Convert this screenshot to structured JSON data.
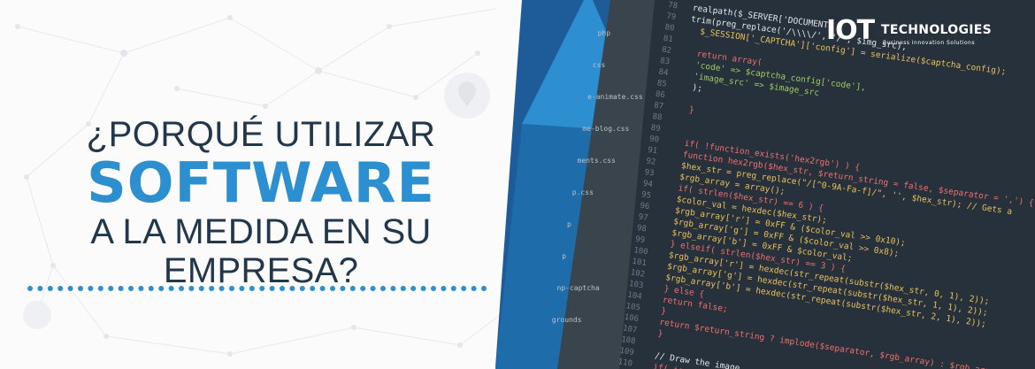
{
  "headline": {
    "line1": "¿PORQUÉ UTILIZAR",
    "line2": "SOFTWARE",
    "line3": "A LA MEDIDA EN SU EMPRESA?"
  },
  "logo": {
    "mark": "IOT",
    "name": "TECHNOLOGIES",
    "tagline": "Business Innovation Solutions"
  },
  "colors": {
    "accent_blue": "#2b8fd0",
    "dark_blue": "#1f5e9c",
    "navy_text": "#22374b",
    "editor_bg": "#2a3540"
  },
  "editor": {
    "sidebar_files": [
      "php",
      "css",
      "e-animate.css",
      "me-blog.css",
      "ments.css",
      "p.css",
      "p",
      "p",
      "np-captcha",
      "grounds"
    ],
    "code_lines": [
      {
        "num": "78",
        "text": "realpath($_SERVER['DOCUMENT"
      },
      {
        "num": "79",
        "text": "trim(preg_replace('/\\\\\\\\/', '/', $img_src),"
      },
      {
        "num": "80",
        "text": "$_SESSION['_CAPTCHA']['config'] = serialize($captcha_config);"
      },
      {
        "num": "81",
        "text": ""
      },
      {
        "num": "82",
        "text": "return array("
      },
      {
        "num": "83",
        "text": "'code' => $captcha_config['code'],"
      },
      {
        "num": "84",
        "text": "'image_src' => $image_src"
      },
      {
        "num": "85",
        "text": ");"
      },
      {
        "num": "86",
        "text": ""
      },
      {
        "num": "87",
        "text": "}"
      },
      {
        "num": "88",
        "text": ""
      },
      {
        "num": "89",
        "text": ""
      },
      {
        "num": "90",
        "text": "if( !function_exists('hex2rgb') ) {"
      },
      {
        "num": "91",
        "text": "function hex2rgb($hex_str, $return_string = false, $separator = ',') {"
      },
      {
        "num": "92",
        "text": "$hex_str = preg_replace(\"/[^0-9A-Fa-f]/\", '', $hex_str); // Gets a"
      },
      {
        "num": "93",
        "text": "$rgb_array = array();"
      },
      {
        "num": "94",
        "text": "if( strlen($hex_str) == 6 ) {"
      },
      {
        "num": "95",
        "text": "$color_val = hexdec($hex_str);"
      },
      {
        "num": "96",
        "text": "$rgb_array['r'] = 0xFF & ($color_val >> 0x10);"
      },
      {
        "num": "97",
        "text": "$rgb_array['g'] = 0xFF & ($color_val >> 0x8);"
      },
      {
        "num": "98",
        "text": "$rgb_array['b'] = 0xFF & $color_val;"
      },
      {
        "num": "99",
        "text": "} elseif( strlen($hex_str) == 3 ) {"
      },
      {
        "num": "100",
        "text": "$rgb_array['r'] = hexdec(str_repeat(substr($hex_str, 0, 1), 2));"
      },
      {
        "num": "101",
        "text": "$rgb_array['g'] = hexdec(str_repeat(substr($hex_str, 1, 1), 2));"
      },
      {
        "num": "102",
        "text": "$rgb_array['b'] = hexdec(str_repeat(substr($hex_str, 2, 1), 2));"
      },
      {
        "num": "103",
        "text": "} else {"
      },
      {
        "num": "104",
        "text": "return false;"
      },
      {
        "num": "105",
        "text": "}"
      },
      {
        "num": "106",
        "text": "return $return_string ? implode($separator, $rgb_array) : $rgb_array;"
      },
      {
        "num": "107",
        "text": "}"
      },
      {
        "num": "108",
        "text": ""
      },
      {
        "num": "109",
        "text": "// Draw the image"
      },
      {
        "num": "110",
        "text": "if( isset($_GET"
      }
    ]
  }
}
